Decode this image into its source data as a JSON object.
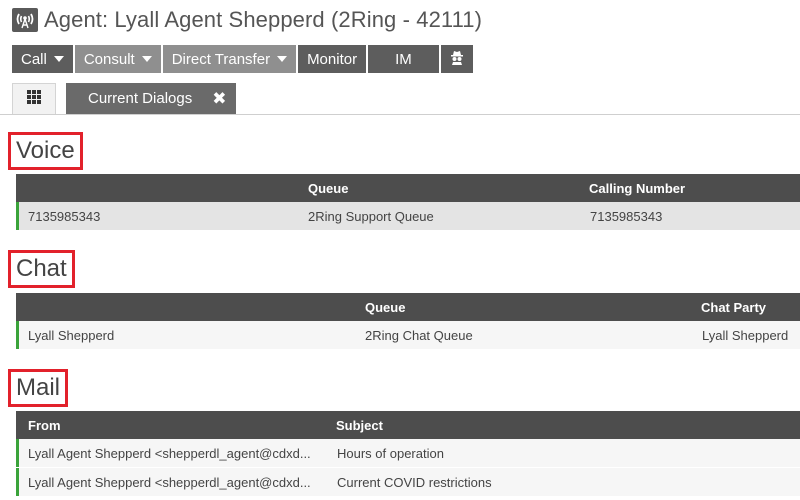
{
  "header": {
    "title": "Agent: Lyall Agent Shepperd (2Ring - 42111)",
    "icon": "radio-tower-icon"
  },
  "toolbar": {
    "call": "Call",
    "consult": "Consult",
    "direct_transfer": "Direct Transfer",
    "monitor": "Monitor",
    "im": "IM",
    "spy_icon": "spy-icon"
  },
  "tabs": {
    "grid_icon": "grid-icon",
    "current_dialogs": "Current Dialogs",
    "close": "✖"
  },
  "voice": {
    "label": "Voice",
    "columns": [
      "Queue",
      "Calling Number"
    ],
    "rows": [
      {
        "number": "7135985343",
        "queue": "2Ring Support Queue",
        "calling_number": "7135985343"
      }
    ]
  },
  "chat": {
    "label": "Chat",
    "columns": [
      "Queue",
      "Chat Party"
    ],
    "rows": [
      {
        "name": "Lyall Shepperd",
        "queue": "2Ring Chat Queue",
        "chat_party": "Lyall Shepperd"
      }
    ]
  },
  "mail": {
    "label": "Mail",
    "columns": [
      "From",
      "Subject"
    ],
    "rows": [
      {
        "from": "Lyall Agent Shepperd <shepperdl_agent@cdxd...",
        "subject": "Hours of operation"
      },
      {
        "from": "Lyall Agent Shepperd <shepperdl_agent@cdxd...",
        "subject": "Current COVID restrictions"
      }
    ]
  },
  "colors": {
    "highlight_border": "#e2212b",
    "row_status": "#3aa33a",
    "toolbar_dark": "#5d5d5d",
    "toolbar_light": "#8f8f8f"
  }
}
